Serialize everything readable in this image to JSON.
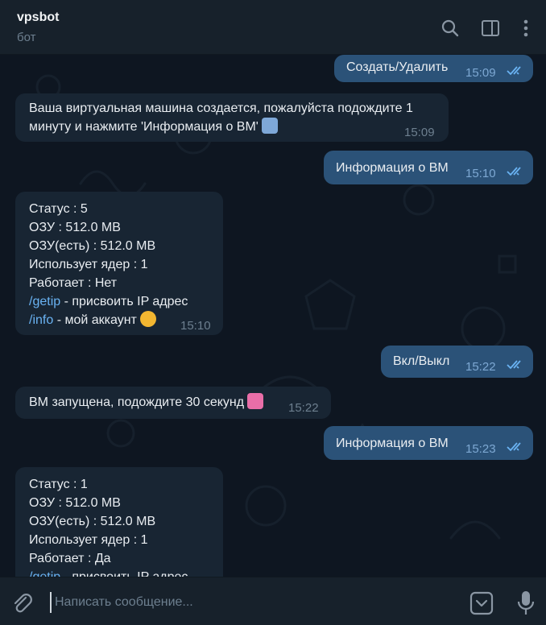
{
  "header": {
    "title": "vpsbot",
    "subtitle": "бот",
    "search_icon": "search-icon",
    "panel_icon": "sidebar-panel-icon",
    "menu_icon": "more-vertical-icon"
  },
  "messages": [
    {
      "direction": "out",
      "lines": [
        "Создать/Удалить"
      ],
      "time": "15:09",
      "status": "read"
    },
    {
      "direction": "in",
      "lines": [
        "Ваша виртуальная машина создается, пожалуйста подождите 1",
        "минуту и нажмите 'Информация о ВМ'"
      ],
      "emoji": "restroom",
      "time": "15:09"
    },
    {
      "direction": "out",
      "lines": [
        "Информация о ВМ"
      ],
      "time": "15:10",
      "status": "read"
    },
    {
      "direction": "in",
      "lines": [
        "Статус : 5",
        "ОЗУ : 512.0 MB",
        "ОЗУ(есть) : 512.0 MB",
        "Использует ядер : 1",
        "Работает : Нет"
      ],
      "links": [
        {
          "cmd": "/getip",
          "text": " - присвоить IP адрес"
        },
        {
          "cmd": "/info",
          "text": " - мой аккаунт"
        }
      ],
      "emoji": "cat",
      "time": "15:10"
    },
    {
      "direction": "out",
      "lines": [
        "Вкл/Выкл"
      ],
      "time": "15:22",
      "status": "read"
    },
    {
      "direction": "in",
      "lines": [
        "ВМ запущена, подождите 30 секунд"
      ],
      "emoji": "ribbon",
      "time": "15:22"
    },
    {
      "direction": "out",
      "lines": [
        "Информация о ВМ"
      ],
      "time": "15:23",
      "status": "read"
    },
    {
      "direction": "in",
      "lines": [
        "Статус : 1",
        "ОЗУ : 512.0 MB",
        "ОЗУ(есть) : 512.0 MB",
        "Использует ядер : 1",
        "Работает : Да"
      ],
      "links": [
        {
          "cmd": "/getip",
          "text": " - присвоить IP адрес"
        }
      ]
    }
  ],
  "composer": {
    "placeholder": "Написать сообщение...",
    "attach_icon": "paperclip-icon",
    "bot_menu_icon": "bot-commands-icon",
    "mic_icon": "microphone-icon"
  },
  "colors": {
    "background": "#0e1621",
    "header": "#17212b",
    "incoming": "#182533",
    "outgoing": "#2b5278",
    "link": "#6ab3f3",
    "read_ticks": "#6ab3f3"
  }
}
